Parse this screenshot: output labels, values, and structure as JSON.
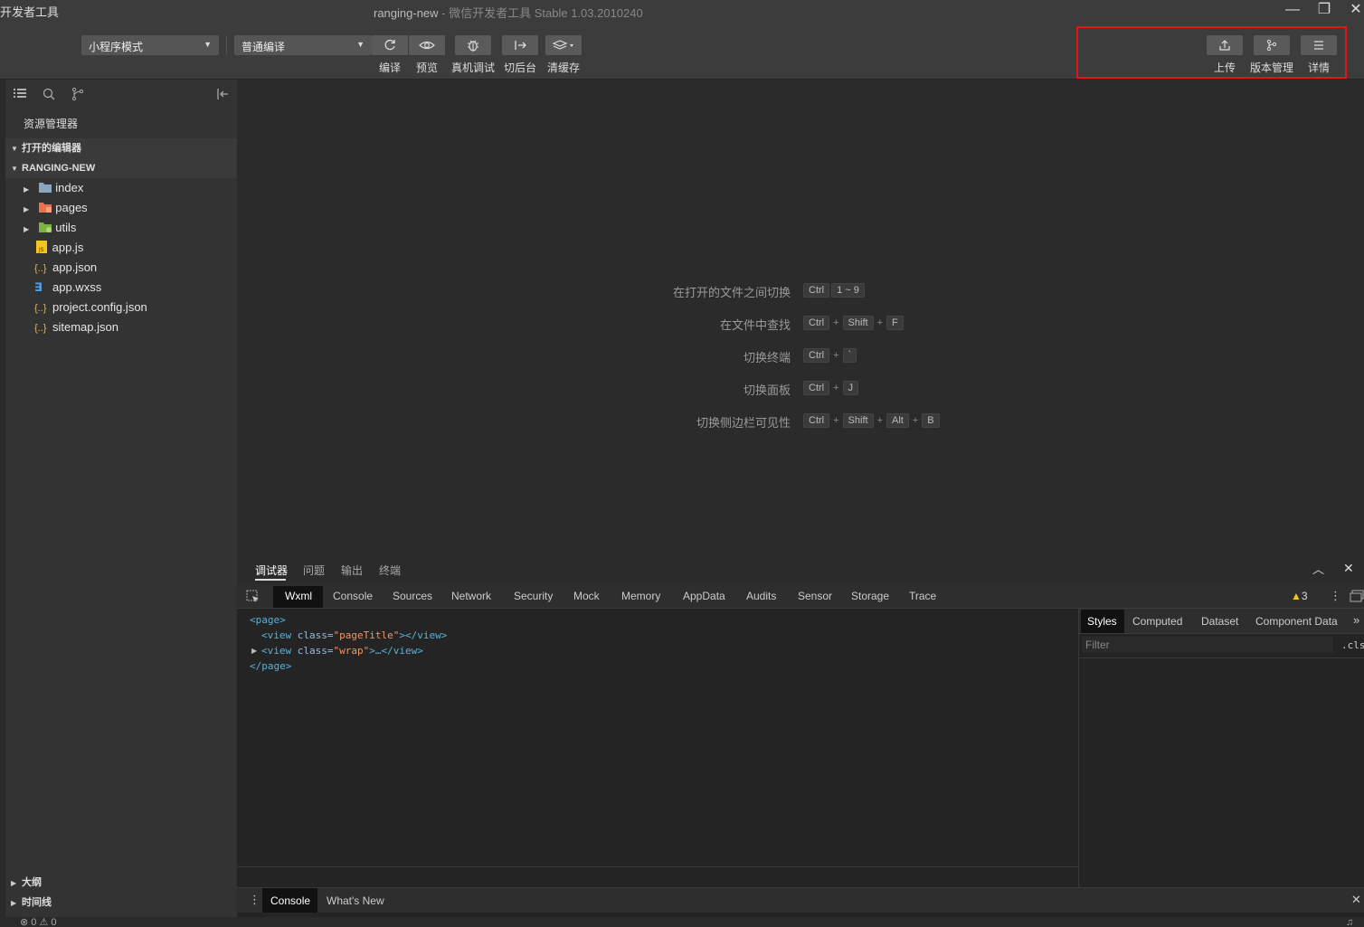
{
  "window": {
    "app_name": "开发者工具",
    "title_main": "ranging-new",
    "title_sep": " - ",
    "title_sub": "微信开发者工具 Stable 1.03.2010240",
    "minimize": "—",
    "restore": "❐",
    "close": "✕"
  },
  "toolbar": {
    "mode_select": "小程序模式",
    "compile_select": "普通编译",
    "buttons": {
      "compile": "编译",
      "preview": "预览",
      "remote_debug": "真机调试",
      "background": "切后台",
      "clear_cache": "清缓存",
      "upload": "上传",
      "version": "版本管理",
      "details": "详情"
    }
  },
  "sidebar": {
    "explorer_title": "资源管理器",
    "open_editors": "打开的编辑器",
    "project": "RANGING-NEW",
    "files": [
      {
        "name": "index",
        "icon": "folder-icon"
      },
      {
        "name": "pages",
        "icon": "folder-pages-icon"
      },
      {
        "name": "utils",
        "icon": "folder-utils-icon"
      },
      {
        "name": "app.js",
        "icon": "js-file-icon"
      },
      {
        "name": "app.json",
        "icon": "json-file-icon"
      },
      {
        "name": "app.wxss",
        "icon": "css-file-icon"
      },
      {
        "name": "project.config.json",
        "icon": "json-file-icon"
      },
      {
        "name": "sitemap.json",
        "icon": "json-file-icon"
      }
    ],
    "outline": "大纲",
    "timeline": "时间线"
  },
  "editor_hints": [
    {
      "label": "在打开的文件之间切换",
      "keys": [
        "Ctrl",
        "1 ~ 9"
      ],
      "sep": " "
    },
    {
      "label": "在文件中查找",
      "keys": [
        "Ctrl",
        "Shift",
        "F"
      ],
      "sep": "+"
    },
    {
      "label": "切换终端",
      "keys": [
        "Ctrl",
        "`"
      ],
      "sep": "+"
    },
    {
      "label": "切换面板",
      "keys": [
        "Ctrl",
        "J"
      ],
      "sep": "+"
    },
    {
      "label": "切换侧边栏可见性",
      "keys": [
        "Ctrl",
        "Shift",
        "Alt",
        "B"
      ],
      "sep": "+"
    }
  ],
  "devtools": {
    "top_tabs": [
      "调试器",
      "问题",
      "输出",
      "终端"
    ],
    "panel_tabs": [
      "Wxml",
      "Console",
      "Sources",
      "Network",
      "Security",
      "Mock",
      "Memory",
      "AppData",
      "Audits",
      "Sensor",
      "Storage",
      "Trace"
    ],
    "warnings": "3",
    "wxml": {
      "l1": "<page>",
      "l2_open": "<view ",
      "l2_attr": "class=",
      "l2_val": "\"pageTitle\"",
      "l2_close": "></view>",
      "l3_open": "<view ",
      "l3_attr": "class=",
      "l3_val": "\"wrap\"",
      "l3_close": ">…</view>",
      "l4": "</page>"
    },
    "style_tabs": [
      "Styles",
      "Computed",
      "Dataset",
      "Component Data"
    ],
    "more": "»",
    "filter_placeholder": "Filter",
    "cls": ".cls",
    "drawer_tabs": [
      "Console",
      "What's New"
    ]
  },
  "status": {
    "errors": "0",
    "warnings": "0"
  }
}
